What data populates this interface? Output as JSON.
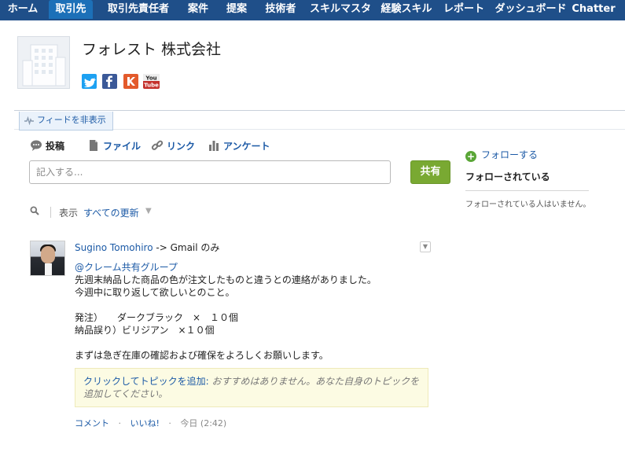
{
  "tabs": [
    {
      "label": "ホーム",
      "active": false
    },
    {
      "label": "取引先",
      "active": true
    },
    {
      "label": "取引先責任者",
      "active": false
    },
    {
      "label": "案件",
      "active": false
    },
    {
      "label": "提案",
      "active": false
    },
    {
      "label": "技術者",
      "active": false
    },
    {
      "label": "スキルマスタ",
      "active": false
    },
    {
      "label": "経験スキル",
      "active": false
    },
    {
      "label": "レポート",
      "active": false
    },
    {
      "label": "ダッシュボード",
      "active": false
    },
    {
      "label": "Chatter",
      "active": false
    }
  ],
  "account": {
    "name": "フォレスト 株式会社",
    "social": [
      {
        "name": "twitter-icon",
        "glyph": "t",
        "color": "#1da1f2"
      },
      {
        "name": "facebook-icon",
        "glyph": "f",
        "color": "#3b5998"
      },
      {
        "name": "klout-icon",
        "glyph": "K",
        "color": "#e35a2b"
      },
      {
        "name": "youtube-icon",
        "glyph": "You",
        "color": "#c4302b"
      }
    ]
  },
  "feed_toggle": {
    "label": "フィードを非表示"
  },
  "publisher": {
    "items": [
      {
        "label": "投稿",
        "icon": "speech-bubble-icon",
        "active": true
      },
      {
        "label": "ファイル",
        "icon": "file-icon",
        "active": false
      },
      {
        "label": "リンク",
        "icon": "link-icon",
        "active": false
      },
      {
        "label": "アンケート",
        "icon": "poll-icon",
        "active": false
      }
    ],
    "placeholder": "記入する...",
    "share_label": "共有"
  },
  "filter": {
    "label": "表示",
    "value": "すべての更新"
  },
  "post": {
    "author": "Sugino Tomohiro",
    "audience": " -> Gmail のみ",
    "mention": "@クレーム共有グループ",
    "lines": [
      "先週末納品した商品の色が注文したものと違うとの連絡がありました。",
      "今週中に取り返して欲しいとのこと。",
      "",
      "発注）　　ダークブラック　×　１０個",
      "納品誤り）ビリジアン　×１０個",
      "",
      "まずは急ぎ在庫の確認および確保をよろしくお願いします。"
    ],
    "topic_link": "クリックしてトピックを追加:",
    "topic_hint": "おすすめはありません。あなた自身のトピックを追加してください。",
    "actions": {
      "comment": "コメント",
      "like": "いいね!",
      "time": "今日 (2:42)",
      "separator": "·"
    }
  },
  "sidebar": {
    "follow_label": "フォローする",
    "followers_title": "フォローされている",
    "followers_empty": "フォローされている人はいません。"
  }
}
